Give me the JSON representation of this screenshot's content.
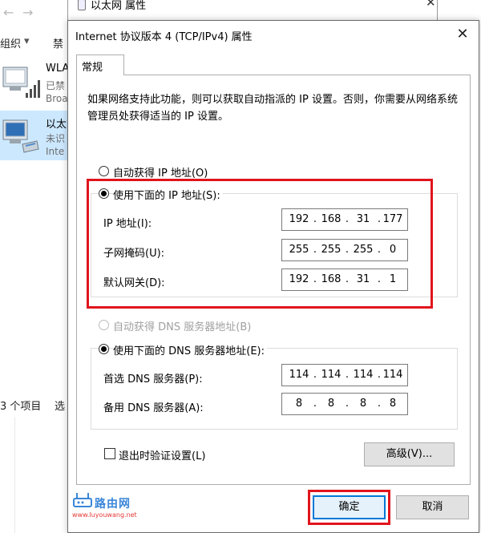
{
  "background": {
    "parent_dialog_title": "以太网 属性",
    "toolbar": {
      "organize": "组织",
      "disable": "禁"
    },
    "adapters": [
      {
        "name": "WLA",
        "status": "已禁",
        "device": "Broa"
      },
      {
        "name": "以太",
        "status": "未识",
        "device": "Inte"
      }
    ],
    "status_bar": {
      "count": "3 个项目",
      "selected": "选"
    }
  },
  "dialog": {
    "title": "Internet 协议版本 4 (TCP/IPv4) 属性",
    "tab": "常规",
    "description": "如果网络支持此功能，则可以获取自动指派的 IP 设置。否则，你需要从网络系统管理员处获得适当的 IP 设置。",
    "ip": {
      "auto_label": "自动获得 IP 地址(O)",
      "manual_label": "使用下面的 IP 地址(S):",
      "address_label": "IP 地址(I):",
      "address": [
        "192",
        "168",
        "31",
        "177"
      ],
      "mask_label": "子网掩码(U):",
      "mask": [
        "255",
        "255",
        "255",
        "0"
      ],
      "gateway_label": "默认网关(D):",
      "gateway": [
        "192",
        "168",
        "31",
        "1"
      ]
    },
    "dns": {
      "auto_label": "自动获得 DNS 服务器地址(B)",
      "manual_label": "使用下面的 DNS 服务器地址(E):",
      "preferred_label": "首选 DNS 服务器(P):",
      "preferred": [
        "114",
        "114",
        "114",
        "114"
      ],
      "alternate_label": "备用 DNS 服务器(A):",
      "alternate": [
        "8",
        "8",
        "8",
        "8"
      ]
    },
    "validate_label": "退出时验证设置(L)",
    "advanced_button": "高级(V)...",
    "ok_button": "确定",
    "cancel_button": "取消"
  },
  "watermark": {
    "name": "路由网",
    "url": "www.luyouwang.net"
  },
  "colors": {
    "highlight_red": "#e1141c",
    "accent_blue": "#0078d7",
    "selection": "#cce8ff"
  }
}
